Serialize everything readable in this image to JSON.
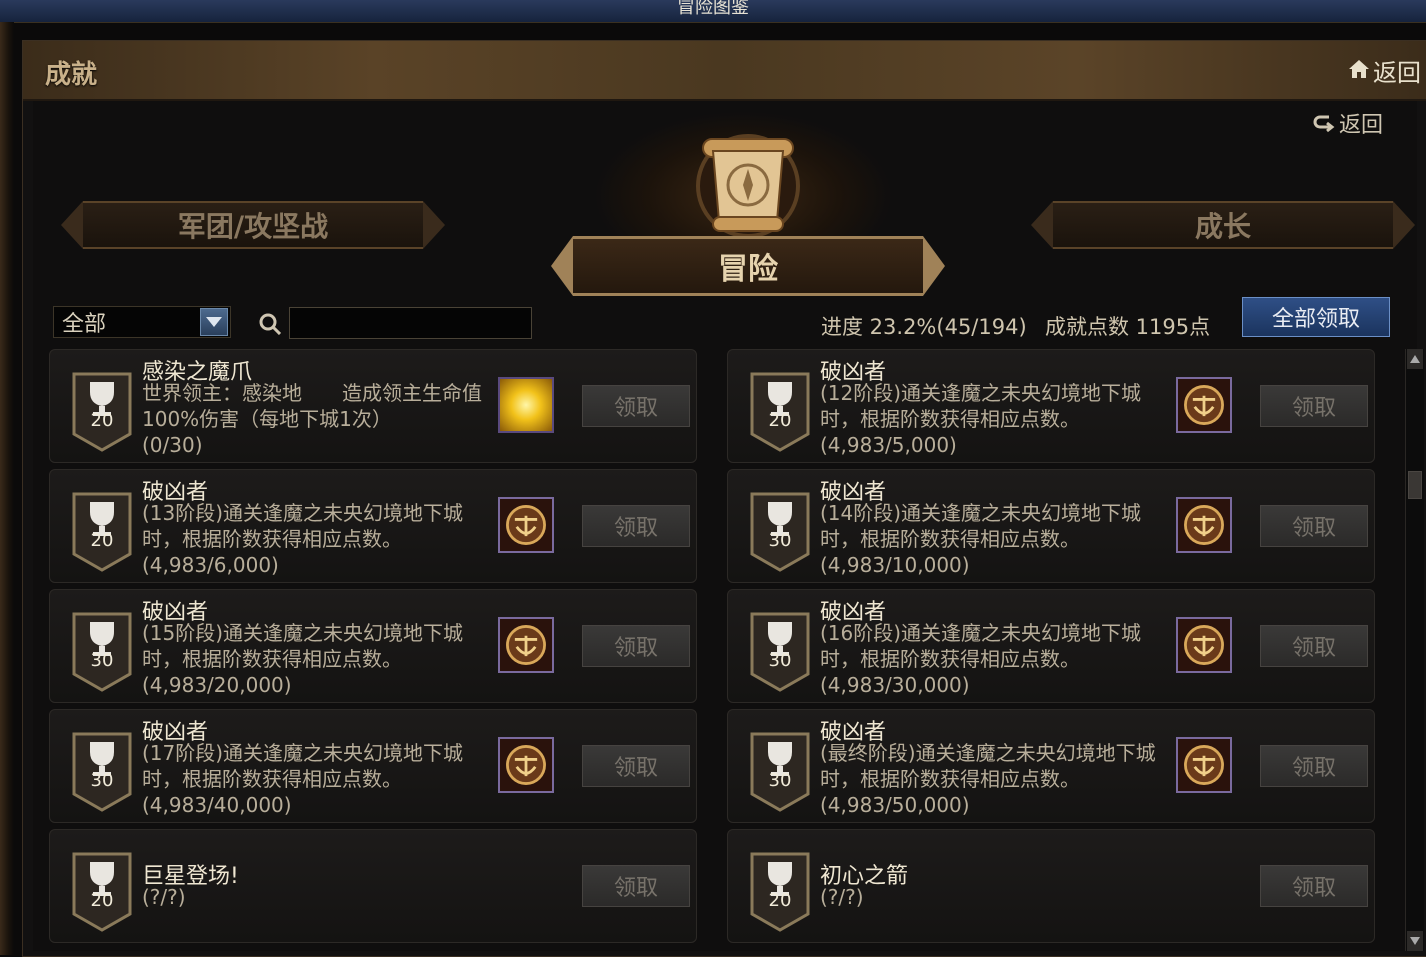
{
  "window": {
    "title": "冒险图鉴"
  },
  "header": {
    "title": "成就",
    "back_label": "返回"
  },
  "nav": {
    "back_label": "返回"
  },
  "tabs": {
    "left": "军团/攻坚战",
    "center": "冒险",
    "right": "成长"
  },
  "toolbar": {
    "filter_value": "全部",
    "search_placeholder": "",
    "progress": "进度 23.2%(45/194)",
    "points": "成就点数 1195点",
    "claim_all_label": "全部领取"
  },
  "achievements": [
    {
      "title": "感染之魔爪",
      "desc": "世界领主：感染地　　造成领主生命值100%伤害（每地下城1次）",
      "progress": "(0/30)",
      "points": "20",
      "icon": "gold-star-icon",
      "claim": "领取"
    },
    {
      "title": "破凶者",
      "desc": "(12阶段)通关逢魔之未央幻境地下城时，根据阶数获得相应点数。",
      "progress": "(4,983/5,000)",
      "points": "20",
      "icon": "demon-crest-icon",
      "claim": "领取"
    },
    {
      "title": "破凶者",
      "desc": "(13阶段)通关逢魔之未央幻境地下城时，根据阶数获得相应点数。",
      "progress": "(4,983/6,000)",
      "points": "20",
      "icon": "demon-crest-icon",
      "claim": "领取"
    },
    {
      "title": "破凶者",
      "desc": "(14阶段)通关逢魔之未央幻境地下城时，根据阶数获得相应点数。",
      "progress": "(4,983/10,000)",
      "points": "30",
      "icon": "demon-crest-icon",
      "claim": "领取"
    },
    {
      "title": "破凶者",
      "desc": "(15阶段)通关逢魔之未央幻境地下城时，根据阶数获得相应点数。",
      "progress": "(4,983/20,000)",
      "points": "30",
      "icon": "demon-crest-icon",
      "claim": "领取"
    },
    {
      "title": "破凶者",
      "desc": "(16阶段)通关逢魔之未央幻境地下城时，根据阶数获得相应点数。",
      "progress": "(4,983/30,000)",
      "points": "30",
      "icon": "demon-crest-icon",
      "claim": "领取"
    },
    {
      "title": "破凶者",
      "desc": "(17阶段)通关逢魔之未央幻境地下城时，根据阶数获得相应点数。",
      "progress": "(4,983/40,000)",
      "points": "30",
      "icon": "demon-crest-icon",
      "claim": "领取"
    },
    {
      "title": "破凶者",
      "desc": "(最终阶段)通关逢魔之未央幻境地下城时，根据阶数获得相应点数。",
      "progress": "(4,983/50,000)",
      "points": "30",
      "icon": "demon-crest-icon",
      "claim": "领取"
    },
    {
      "title": "巨星登场!",
      "desc": "",
      "progress": "(?/?)",
      "points": "20",
      "icon": "",
      "claim": "领取"
    },
    {
      "title": "初心之箭",
      "desc": "",
      "progress": "(?/?)",
      "points": "20",
      "icon": "",
      "claim": "领取"
    }
  ],
  "colors": {
    "accent_gold": "#a08258",
    "claim_all_blue": "#2f4f86",
    "icon_border": "#7a6a9e"
  }
}
